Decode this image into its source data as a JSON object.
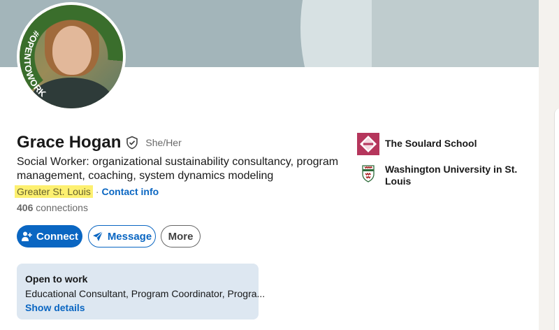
{
  "profile": {
    "name": "Grace Hogan",
    "pronouns": "She/Her",
    "headline": "Social Worker: organizational sustainability consultancy, program management, coaching, system dynamics modeling",
    "location": "Greater St. Louis",
    "separator": "·",
    "contact_info": "Contact info",
    "connections_count": "406",
    "connections_label": "connections",
    "avatar_badge": "#OPENTOWORK"
  },
  "actions": {
    "connect": "Connect",
    "message": "Message",
    "more": "More"
  },
  "open_to_work": {
    "title": "Open to work",
    "roles": "Educational Consultant, Program Coordinator, Progra...",
    "show_details": "Show details"
  },
  "education": [
    {
      "name": "The Soulard School",
      "icon": "soulard-school-logo"
    },
    {
      "name": "Washington University in St. Louis",
      "icon": "washu-logo"
    }
  ],
  "colors": {
    "primary": "#0a66c2",
    "highlight": "#fdf070",
    "open_to_work_green": "#3a6e2c",
    "open_to_work_box": "#dde7f1"
  },
  "icons": {
    "verified": "shield-check-icon",
    "connect": "person-add-icon",
    "message": "send-icon"
  }
}
